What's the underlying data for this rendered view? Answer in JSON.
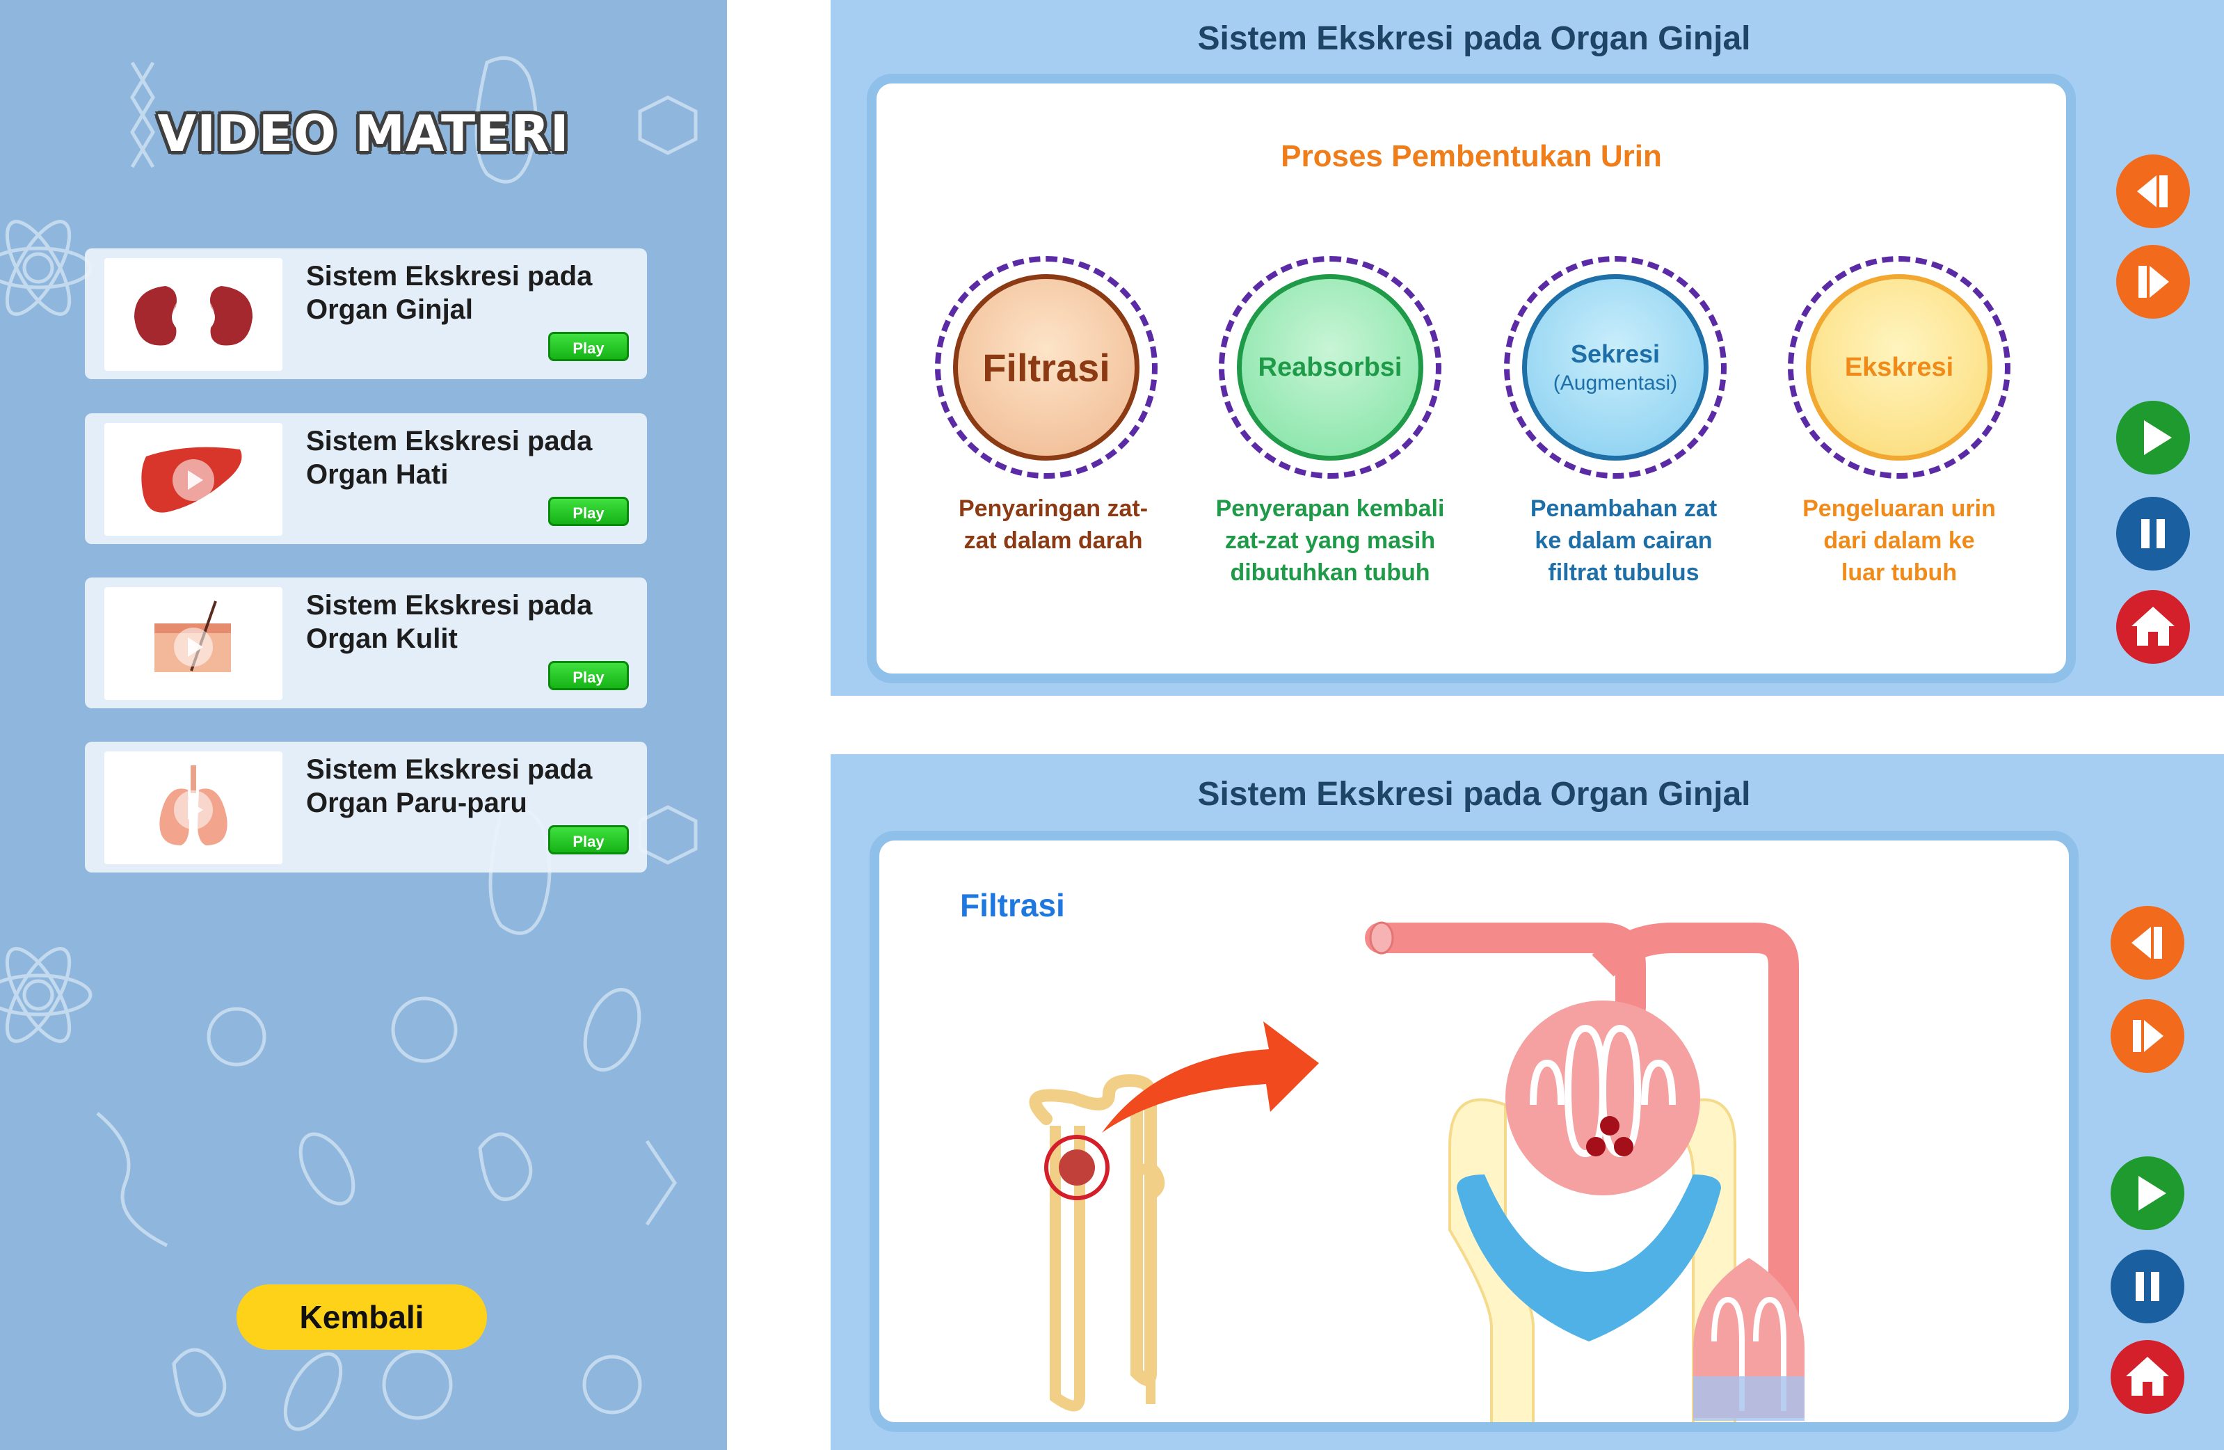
{
  "left_panel": {
    "title": "VIDEO MATERI",
    "cards": [
      {
        "title": "Sistem Ekskresi pada Organ Ginjal",
        "play_label": "Play",
        "thumb": "kidney-image"
      },
      {
        "title": "Sistem Ekskresi pada Organ Hati",
        "play_label": "Play",
        "thumb": "liver-image"
      },
      {
        "title": "Sistem Ekskresi pada Organ Kulit",
        "play_label": "Play",
        "thumb": "skin-image"
      },
      {
        "title": "Sistem Ekskresi pada Organ Paru-paru",
        "play_label": "Play",
        "thumb": "lungs-image"
      }
    ],
    "back_label": "Kembali"
  },
  "top_panel": {
    "title": "Sistem Ekskresi pada Organ Ginjal",
    "heading": "Proses Pembentukan Urin",
    "stages": [
      {
        "name": "Filtrasi",
        "desc_line1": "Penyaringan zat-",
        "desc_line2": "zat dalam darah",
        "desc_line3": "",
        "color": "#8b3a14"
      },
      {
        "name": "Reabsorbsi",
        "desc_line1": "Penyerapan kembali",
        "desc_line2": "zat-zat yang masih",
        "desc_line3": "dibutuhkan tubuh",
        "color": "#1f9a48"
      },
      {
        "name": "Sekresi",
        "name_sub": "(Augmentasi)",
        "desc_line1": "Penambahan zat",
        "desc_line2": "ke dalam cairan",
        "desc_line3": "filtrat tubulus",
        "color": "#1e6fa8"
      },
      {
        "name": "Ekskresi",
        "desc_line1": "Pengeluaran urin",
        "desc_line2": "dari dalam ke",
        "desc_line3": "luar tubuh",
        "color": "#f08a18"
      }
    ]
  },
  "bottom_panel": {
    "title": "Sistem Ekskresi pada Organ Ginjal",
    "heading": "Filtrasi"
  },
  "controls": {
    "icons": [
      "rewind-icon",
      "forward-icon",
      "play-icon",
      "pause-icon",
      "home-icon"
    ],
    "colors": {
      "orange": "#f26a1b",
      "green": "#1f9a2e",
      "blue": "#1a5fa0",
      "red": "#d4202a"
    }
  },
  "colors": {
    "left_bg": "#8fb6dc",
    "panel_bg": "#a6cef2",
    "heading_orange": "#ef7d1a",
    "heading_blue": "#1e78e0",
    "play_green": "#22c322",
    "kembali_yellow": "#ffd21a"
  }
}
